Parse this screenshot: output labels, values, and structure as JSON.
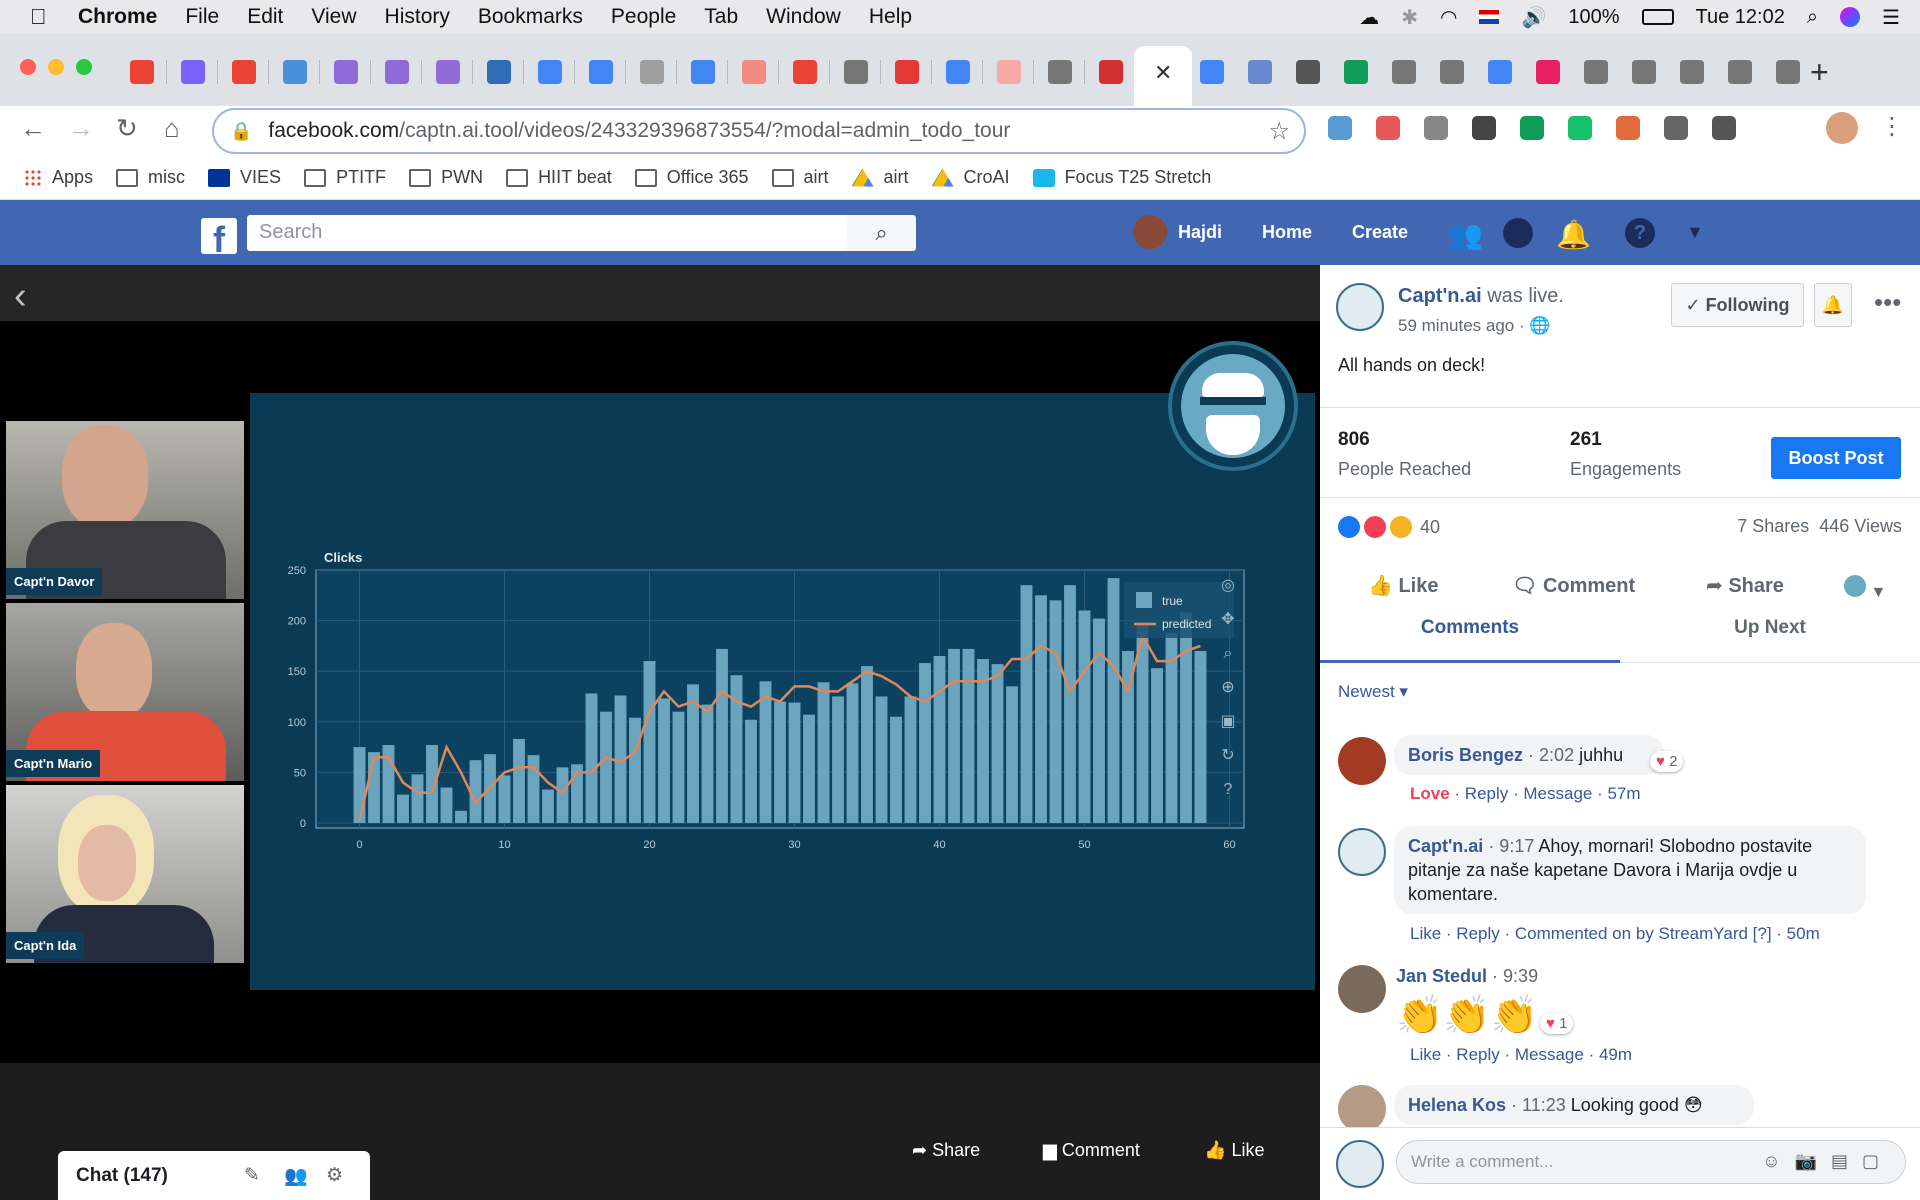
{
  "menubar": {
    "app": "Chrome",
    "items": [
      "File",
      "Edit",
      "View",
      "History",
      "Bookmarks",
      "People",
      "Tab",
      "Window",
      "Help"
    ],
    "battery": "100%",
    "clock": "Tue 12:02"
  },
  "browser": {
    "url_domain": "facebook.com",
    "url_path": "/captn.ai.tool/videos/243329396873554/?modal=admin_todo_tour",
    "bookmarks": [
      "Apps",
      "misc",
      "VIES",
      "PTITF",
      "PWN",
      "HIIT beat",
      "Office 365",
      "airt",
      "airt",
      "CroAI",
      "Focus T25 Stretch"
    ]
  },
  "fb_header": {
    "search_placeholder": "Search",
    "user": "Hajdi",
    "home": "Home",
    "create": "Create"
  },
  "video": {
    "cams": [
      {
        "label": "Capt'n Davor"
      },
      {
        "label": "Capt'n Mario"
      },
      {
        "label": "Capt'n Ida"
      }
    ],
    "share": "Share",
    "comment": "Comment",
    "like": "Like",
    "chat": "Chat (147)"
  },
  "chart_data": {
    "type": "bar",
    "title": "Clicks",
    "xlim": [
      -3,
      61
    ],
    "ylim": [
      -5,
      250
    ],
    "xticks": [
      0,
      10,
      20,
      30,
      40,
      50,
      60
    ],
    "yticks": [
      0,
      50,
      100,
      150,
      200,
      250
    ],
    "legend": [
      "true",
      "predicted"
    ],
    "legend_position": "top-right",
    "x": [
      0,
      1,
      2,
      3,
      4,
      5,
      6,
      7,
      8,
      9,
      10,
      11,
      12,
      13,
      14,
      15,
      16,
      17,
      18,
      19,
      20,
      21,
      22,
      23,
      24,
      25,
      26,
      27,
      28,
      29,
      30,
      31,
      32,
      33,
      34,
      35,
      36,
      37,
      38,
      39,
      40,
      41,
      42,
      43,
      44,
      45,
      46,
      47,
      48,
      49,
      50,
      51,
      52,
      53,
      54,
      55,
      56,
      57,
      58
    ],
    "series": [
      {
        "name": "true",
        "values": [
          75,
          70,
          77,
          28,
          48,
          77,
          35,
          12,
          62,
          68,
          47,
          83,
          67,
          33,
          55,
          58,
          128,
          110,
          126,
          104,
          160,
          123,
          110,
          137,
          117,
          172,
          146,
          102,
          140,
          120,
          119,
          107,
          139,
          125,
          138,
          155,
          125,
          105,
          125,
          158,
          165,
          172,
          172,
          162,
          157,
          135,
          235,
          225,
          220,
          235,
          210,
          202,
          242,
          170,
          197,
          153,
          188,
          208,
          170
        ]
      },
      {
        "name": "predicted",
        "values": [
          2,
          65,
          65,
          40,
          30,
          30,
          75,
          50,
          20,
          35,
          50,
          55,
          55,
          40,
          30,
          50,
          50,
          65,
          60,
          70,
          110,
          130,
          115,
          120,
          110,
          130,
          120,
          115,
          125,
          120,
          135,
          135,
          130,
          130,
          140,
          150,
          145,
          137,
          125,
          120,
          130,
          140,
          140,
          140,
          145,
          162,
          162,
          175,
          168,
          130,
          150,
          168,
          155,
          130,
          185,
          160,
          160,
          170,
          175
        ]
      }
    ]
  },
  "post": {
    "page": "Capt'n.ai",
    "was_live": "was live.",
    "time": "59 minutes ago ·",
    "text": "All hands on deck!",
    "following": "Following",
    "people_reached_num": "806",
    "people_reached": "People Reached",
    "engagements_num": "261",
    "engagements": "Engagements",
    "boost": "Boost Post",
    "reactions": "40",
    "shares": "7 Shares",
    "views": "446 Views",
    "like": "Like",
    "comment": "Comment",
    "share": "Share",
    "tab_comments": "Comments",
    "tab_upnext": "Up Next",
    "sort": "Newest",
    "write_placeholder": "Write a comment..."
  },
  "comments": [
    {
      "name": "Boris Bengez",
      "time": "· 2:02",
      "text": "juhhu",
      "reacts": "2",
      "meta_love": "Love",
      "meta": "· Reply · Message · 57m"
    },
    {
      "name": "Capt'n.ai",
      "time": "· 9:17",
      "text": "Ahoy, mornari! Slobodno postavite pitanje za naše kapetane Davora i Marija ovdje u komentare.",
      "meta": "Like · Reply · Commented on by StreamYard [?] · 50m"
    },
    {
      "name": "Jan Stedul",
      "time": "· 9:39",
      "text": "👏👏👏",
      "reacts": "1",
      "meta": "Like · Reply · Message · 49m"
    },
    {
      "name": "Helena Kos",
      "time": "· 11:23",
      "text": "Looking good"
    }
  ]
}
